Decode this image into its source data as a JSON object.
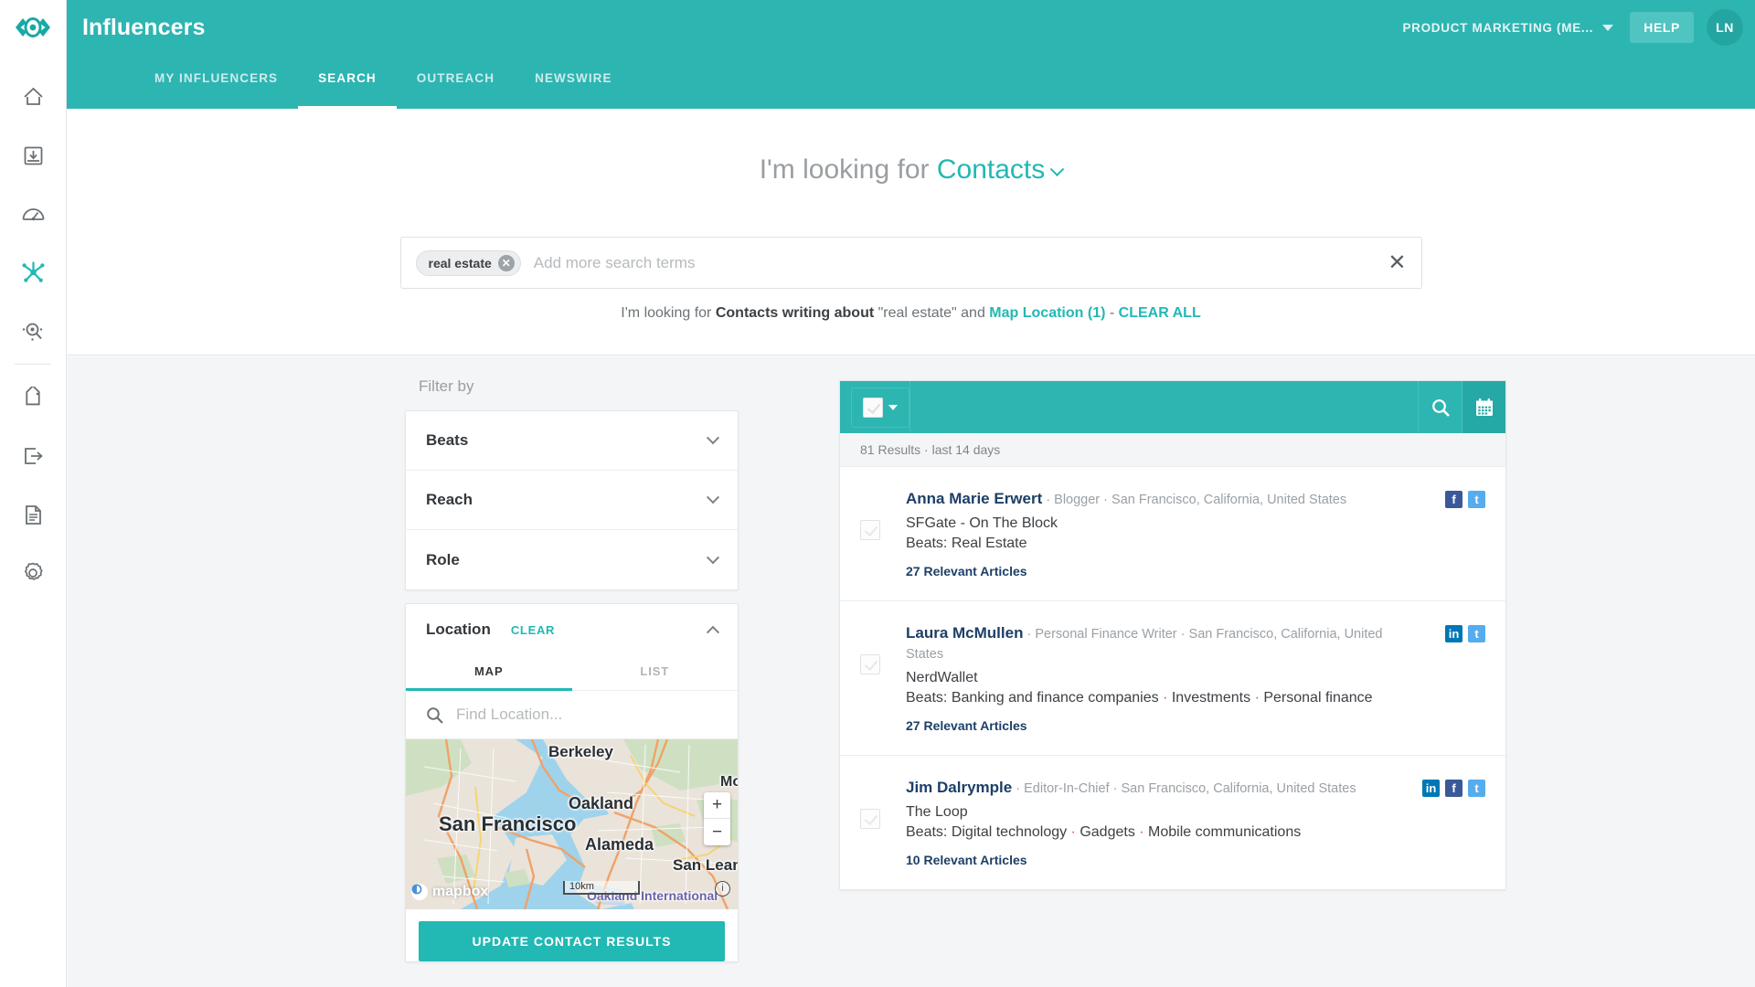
{
  "brand": {
    "name": "Influencers",
    "logo_icon": "eye-logo-icon"
  },
  "header": {
    "account_label": "PRODUCT MARKETING (ME...",
    "help_label": "HELP",
    "avatar_initials": "LN",
    "teal": "#2db5b2",
    "tabs": [
      {
        "label": "MY INFLUENCERS",
        "active": false
      },
      {
        "label": "SEARCH",
        "active": true
      },
      {
        "label": "OUTREACH",
        "active": false
      },
      {
        "label": "NEWSWIRE",
        "active": false
      }
    ]
  },
  "rail": {
    "items": [
      {
        "icon": "home-icon",
        "active": false
      },
      {
        "icon": "inbox-download-icon",
        "active": false
      },
      {
        "icon": "gauge-icon",
        "active": false
      },
      {
        "icon": "network-hub-icon",
        "active": true
      },
      {
        "icon": "search-analytics-icon",
        "active": false
      },
      {
        "icon": "tag-icon",
        "active": false
      },
      {
        "icon": "export-icon",
        "active": false
      },
      {
        "icon": "document-icon",
        "active": false
      },
      {
        "icon": "gear-icon",
        "active": false
      }
    ]
  },
  "hero": {
    "title_prefix": "I'm looking for",
    "title_type": "Contacts",
    "search": {
      "chip_label": "real estate",
      "placeholder": "Add more search terms",
      "value": "",
      "clear_glyph": "✕"
    },
    "summary": {
      "prefix": "I'm looking for",
      "type": "Contacts writing about",
      "term": "\"real estate\"",
      "and": "and",
      "location_link": "Map Location (1)",
      "separator": "-",
      "clear_all": "CLEAR ALL"
    }
  },
  "filters": {
    "heading": "Filter by",
    "rows": [
      {
        "label": "Beats",
        "expanded": false
      },
      {
        "label": "Reach",
        "expanded": false
      },
      {
        "label": "Role",
        "expanded": false
      }
    ],
    "location": {
      "label": "Location",
      "clear_label": "CLEAR",
      "expanded": true,
      "tabs": [
        {
          "label": "MAP",
          "active": true
        },
        {
          "label": "LIST",
          "active": false
        }
      ],
      "find_placeholder": "Find Location...",
      "find_value": "",
      "map": {
        "labels": [
          "Berkeley",
          "Oakland",
          "Alameda",
          "San Francisco",
          "San Lean",
          "Mo",
          "Oakland International"
        ],
        "scale": "10km",
        "attribution": "mapbox",
        "zoom_in": "+",
        "zoom_out": "−"
      },
      "update_button": "UPDATE CONTACT RESULTS"
    }
  },
  "results": {
    "select_all_checked": true,
    "count_text": "81 Results · last 14 days",
    "tools": [
      {
        "icon": "search-icon",
        "name": "search-results-button"
      },
      {
        "icon": "calendar-icon",
        "name": "date-range-button"
      }
    ],
    "rows": [
      {
        "name": "Anna Marie Erwert",
        "role": "Blogger",
        "location": "San Francisco, California, United States",
        "outlet": "SFGate - On The Block",
        "beats_label": "Beats:",
        "beats": [
          "Real Estate"
        ],
        "articles": "27 Relevant Articles",
        "socials": [
          "facebook",
          "twitter"
        ]
      },
      {
        "name": "Laura McMullen",
        "role": "Personal Finance Writer",
        "location": "San Francisco, California, United States",
        "outlet": "NerdWallet",
        "beats_label": "Beats:",
        "beats": [
          "Banking and finance companies",
          "Investments",
          "Personal finance"
        ],
        "articles": "27 Relevant Articles",
        "socials": [
          "linkedin",
          "twitter"
        ]
      },
      {
        "name": "Jim Dalrymple",
        "role": "Editor-In-Chief",
        "location": "San Francisco, California, United States",
        "outlet": "The Loop",
        "beats_label": "Beats:",
        "beats": [
          "Digital technology",
          "Gadgets",
          "Mobile communications"
        ],
        "articles": "10 Relevant Articles",
        "socials": [
          "linkedin",
          "facebook",
          "twitter"
        ]
      }
    ]
  }
}
